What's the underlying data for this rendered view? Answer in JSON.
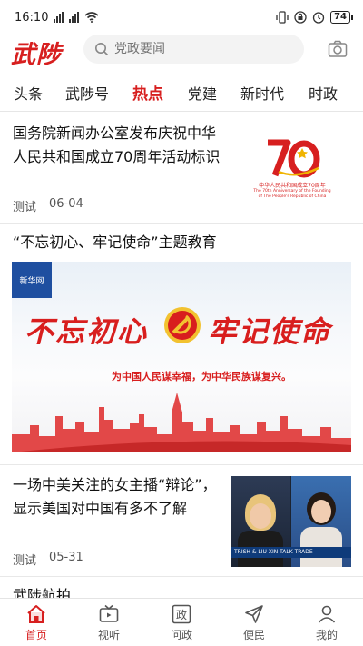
{
  "status_bar": {
    "time": "16:10",
    "battery": "74"
  },
  "header": {
    "logo": "武陟",
    "search_placeholder": "党政要闻"
  },
  "tabs": [
    {
      "label": "头条",
      "active": false
    },
    {
      "label": "武陟号",
      "active": false
    },
    {
      "label": "热点",
      "active": true
    },
    {
      "label": "党建",
      "active": false
    },
    {
      "label": "新时代",
      "active": false
    },
    {
      "label": "时政",
      "active": false
    }
  ],
  "articles": [
    {
      "title": "国务院新闻办公室发布庆祝中华人民共和国成立70周年活动标识",
      "source": "测试",
      "date": "06-04",
      "thumb": {
        "number": "70",
        "caption_cn": "中华人民共和国成立70周年",
        "caption_en": "The 70th Anniversary of the Founding of The People's Republic of China"
      }
    },
    {
      "title": "“不忘初心、牢记使命”主题教育",
      "banner": {
        "heading_left": "不忘初心",
        "heading_right": "牢记使命",
        "subtitle": "为中国人民谋幸福，为中华民族谋复兴。",
        "logo_text": "新华网"
      }
    },
    {
      "title": "一场中美关注的女主播“辩论”，显示美国对中国有多不了解",
      "source": "测试",
      "date": "05-31",
      "thumb": {
        "ticker": "TRISH & LIU XIN TALK TRADE"
      }
    },
    {
      "title": "武陟航拍"
    }
  ],
  "bottom_nav": [
    {
      "label": "首页",
      "icon": "home-icon",
      "active": true
    },
    {
      "label": "视听",
      "icon": "tv-icon",
      "active": false
    },
    {
      "label": "问政",
      "icon": "zheng-icon",
      "active": false
    },
    {
      "label": "便民",
      "icon": "send-icon",
      "active": false
    },
    {
      "label": "我的",
      "icon": "user-icon",
      "active": false
    }
  ],
  "colors": {
    "accent": "#d71f1f"
  }
}
